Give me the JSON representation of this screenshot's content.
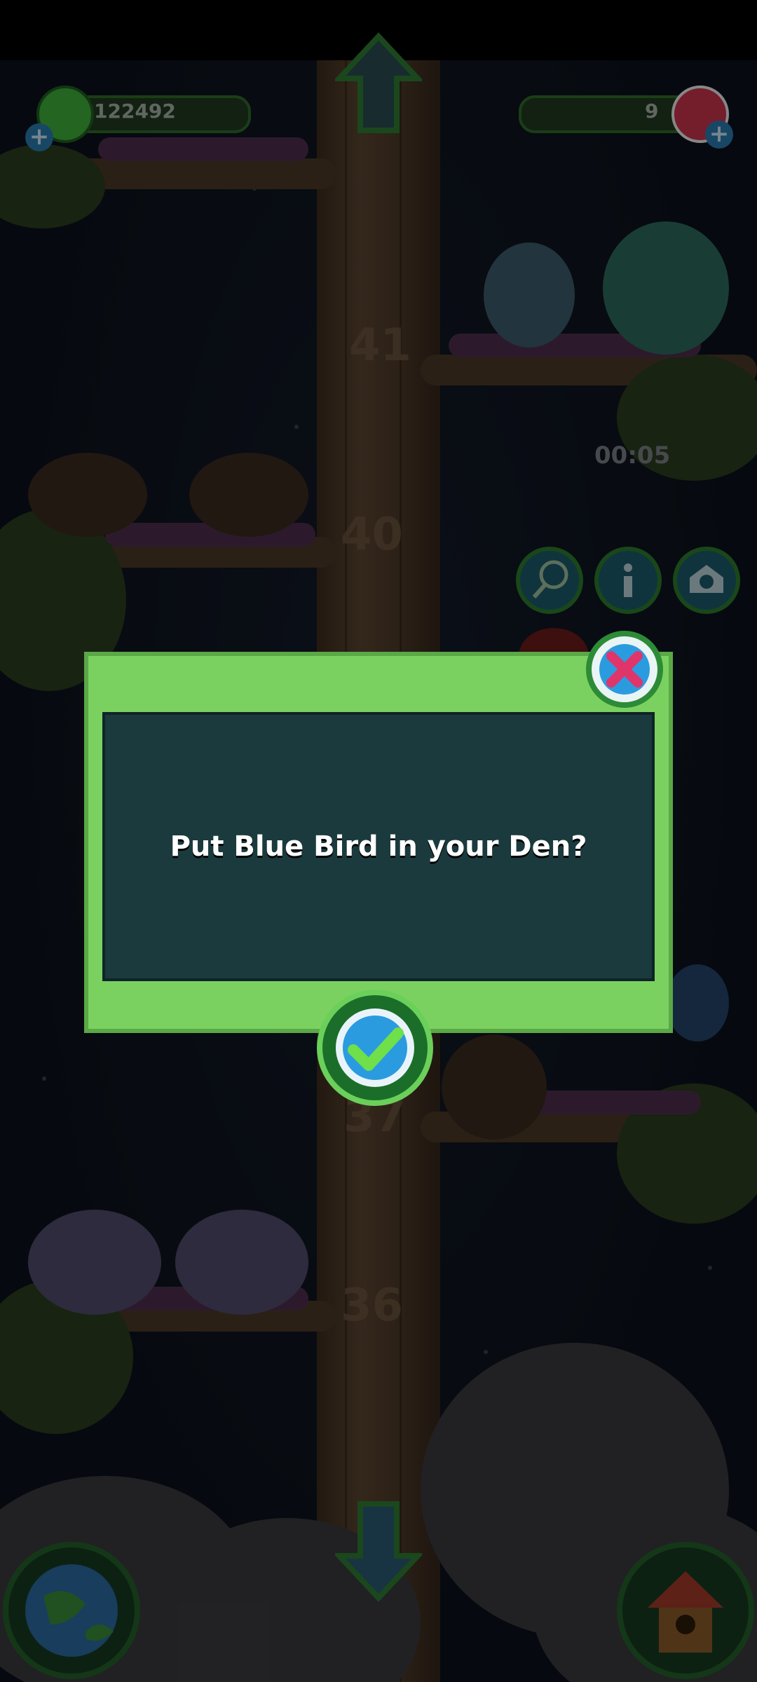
{
  "hud": {
    "coins_value": "122492",
    "gems_value": "9",
    "timer": "00:05"
  },
  "levels": [
    "41",
    "40",
    "37",
    "36"
  ],
  "dialog": {
    "message": "Put Blue Bird in your Den?"
  },
  "icons": {
    "coin": "green-gem-icon",
    "gem": "red-crystal-icon",
    "add_coins": "plus-icon",
    "add_gems": "plus-icon",
    "up": "up-arrow-icon",
    "down": "down-arrow-icon",
    "net": "butterfly-net-icon",
    "info": "info-icon",
    "den": "den-icon",
    "world": "globe-icon",
    "home": "birdhouse-icon",
    "close": "close-icon",
    "confirm": "checkmark-icon"
  },
  "colors": {
    "dialog_frame": "#7bd160",
    "dialog_body": "#1a3a3e",
    "close_x": "#e0356a",
    "confirm_check": "#6fe04a",
    "confirm_bg": "#2b9be0"
  }
}
